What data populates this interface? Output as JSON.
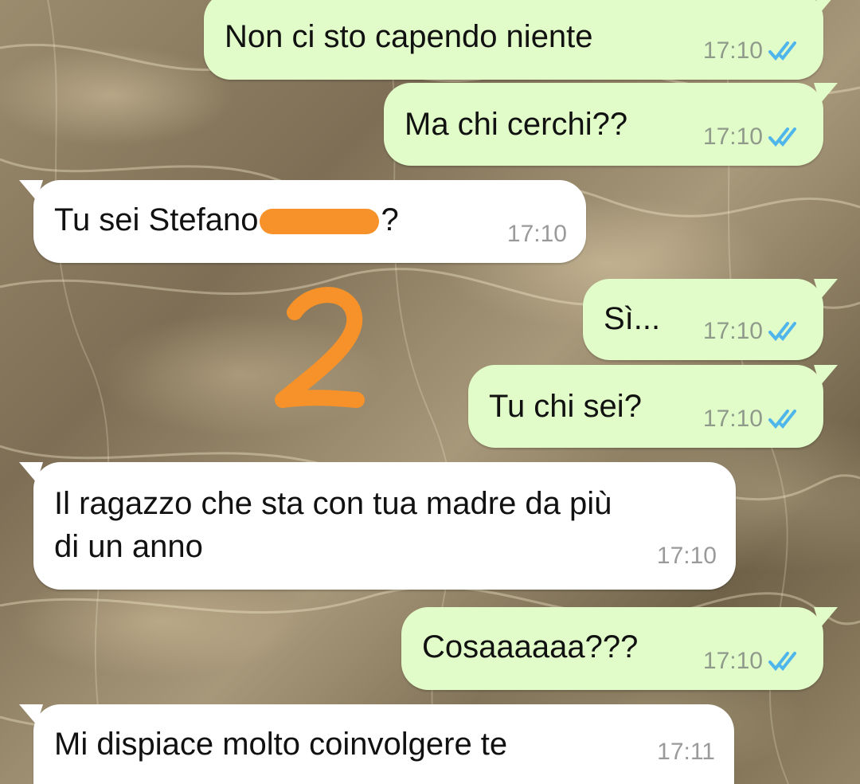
{
  "messages": [
    {
      "side": "out",
      "text": "Non ci sto capendo niente",
      "time": "17:10",
      "status": "read"
    },
    {
      "side": "out",
      "text": "Ma chi cerchi??",
      "time": "17:10",
      "status": "read"
    },
    {
      "side": "in",
      "text_before": "Tu sei Stefano",
      "text_after": "?",
      "time": "17:10"
    },
    {
      "side": "out",
      "text": "Sì...",
      "time": "17:10",
      "status": "read"
    },
    {
      "side": "out",
      "text": "Tu chi sei?",
      "time": "17:10",
      "status": "read"
    },
    {
      "side": "in",
      "line1": "Il ragazzo che sta con tua madre da più",
      "line2": "di un anno",
      "time": "17:10"
    },
    {
      "side": "out",
      "text": "Cosaaaaaa???",
      "time": "17:10",
      "status": "read"
    },
    {
      "side": "in",
      "text": "Mi dispiace molto coinvolgere te",
      "time": "17:11"
    }
  ],
  "colors": {
    "outgoing_bubble": "#e1fcc9",
    "incoming_bubble": "#ffffff",
    "read_ticks": "#4fb6ec",
    "redaction": "#f7922a"
  },
  "icons": {
    "read_receipt": "double-check-icon",
    "annotation": "number-2-scribble"
  }
}
